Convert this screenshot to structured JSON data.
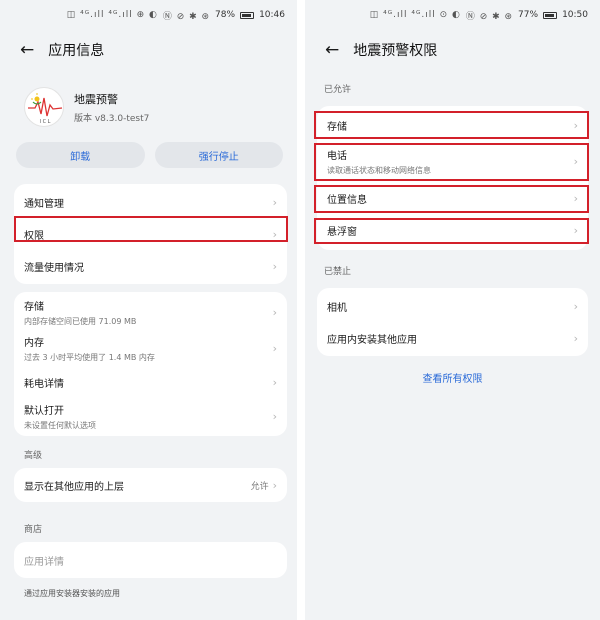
{
  "left": {
    "status": {
      "signals": "◫ ⁴ᴳ.ıll ⁴ᴳ.ıll ⊕ ◐",
      "sys_icons": "Ⓝ ⊘ ✱ ⊛",
      "battery": "78%",
      "time": "10:46"
    },
    "header": {
      "title": "应用信息"
    },
    "app": {
      "name": "地震预警",
      "version": "版本 v8.3.0-test7",
      "logo_text": "I C L"
    },
    "buttons": {
      "uninstall": "卸载",
      "force_stop": "强行停止"
    },
    "group1": [
      {
        "label": "通知管理"
      },
      {
        "label": "权限"
      },
      {
        "label": "流量使用情况"
      }
    ],
    "group2": [
      {
        "label": "存储",
        "sub": "内部存储空间已使用 71.09 MB"
      },
      {
        "label": "内存",
        "sub": "过去 3 小时平均使用了 1.4 MB 内存"
      },
      {
        "label": "耗电详情"
      },
      {
        "label": "默认打开",
        "sub": "未设置任何默认选项"
      }
    ],
    "advanced": {
      "label": "高级",
      "row_label": "显示在其他应用的上层",
      "row_value": "允许"
    },
    "store": {
      "label": "商店",
      "row_label": "应用详情",
      "note": "通过应用安装器安装的应用"
    }
  },
  "right": {
    "status": {
      "signals": "◫ ⁴ᴳ.ıll ⁴ᴳ.ıll ⊙ ◐",
      "sys_icons": "Ⓝ ⊘ ✱ ⊛",
      "battery": "77%",
      "time": "10:50"
    },
    "header": {
      "title": "地震预警权限"
    },
    "allowed_label": "已允许",
    "allowed": [
      {
        "label": "存储"
      },
      {
        "label": "电话",
        "sub": "读取通话状态和移动网络信息"
      },
      {
        "label": "位置信息"
      },
      {
        "label": "悬浮窗"
      }
    ],
    "denied_label": "已禁止",
    "denied": [
      {
        "label": "相机"
      },
      {
        "label": "应用内安装其他应用"
      }
    ],
    "view_all": "查看所有权限"
  },
  "icons": {
    "back": "arrow-left-icon",
    "chevron": "chevron-right-icon"
  },
  "colors": {
    "highlight": "#d3202a",
    "accent": "#2a6ad8",
    "background": "#f1f3f5"
  }
}
